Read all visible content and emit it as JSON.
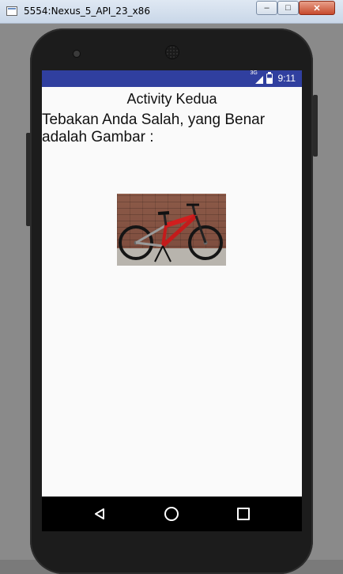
{
  "window": {
    "title": "5554:Nexus_5_API_23_x86",
    "buttons": {
      "minimize": "–",
      "maximize": "□",
      "close": "✕"
    }
  },
  "statusbar": {
    "network": "3G",
    "time": "9:11",
    "color": "#303f9f"
  },
  "activity": {
    "title": "Activity Kedua",
    "message": "Tebakan Anda Salah, yang Benar adalah Gambar :"
  },
  "image": {
    "subject": "mountain bike"
  },
  "navbar": {
    "icons": [
      "back-icon",
      "home-icon",
      "recents-icon"
    ]
  }
}
